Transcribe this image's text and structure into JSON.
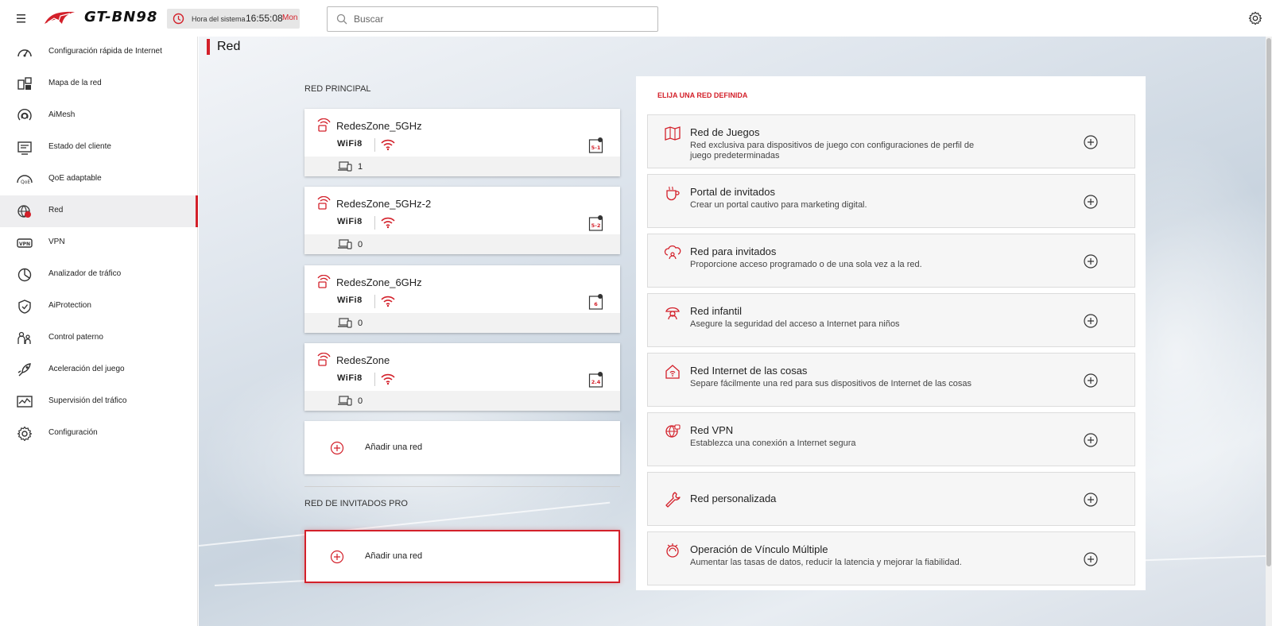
{
  "header": {
    "model": "GT-BN98",
    "system_time_label": "Hora del sistema",
    "time": "16:55:08",
    "day": "Mon",
    "search_placeholder": "Buscar"
  },
  "sidebar": {
    "items": [
      {
        "label": "Configuración rápida de Internet",
        "icon": "gauge-icon"
      },
      {
        "label": "Mapa de la red",
        "icon": "network-map-icon"
      },
      {
        "label": "AiMesh",
        "icon": "aimesh-icon"
      },
      {
        "label": "Estado del cliente",
        "icon": "client-status-icon"
      },
      {
        "label": "QoE adaptable",
        "icon": "qos-icon"
      },
      {
        "label": "Red",
        "icon": "globe-icon",
        "active": true
      },
      {
        "label": "VPN",
        "icon": "vpn-icon"
      },
      {
        "label": "Analizador de tráfico",
        "icon": "pie-chart-icon"
      },
      {
        "label": "AiProtection",
        "icon": "shield-icon"
      },
      {
        "label": "Control paterno",
        "icon": "parental-icon"
      },
      {
        "label": "Aceleración del juego",
        "icon": "rocket-icon"
      },
      {
        "label": "Supervisión del tráfico",
        "icon": "traffic-monitor-icon"
      },
      {
        "label": "Configuración",
        "icon": "gear-icon"
      }
    ]
  },
  "page": {
    "title": "Red",
    "main_section": "RED PRINCIPAL",
    "guest_pro_section": "RED DE INVITADOS PRO",
    "add_network": "Añadir una red",
    "networks": [
      {
        "ssid": "RedesZone_5GHz",
        "wifi_label": "WiFi8",
        "band_label": "5-1",
        "devices": "1"
      },
      {
        "ssid": "RedesZone_5GHz-2",
        "wifi_label": "WiFi8",
        "band_label": "5-2",
        "devices": "0"
      },
      {
        "ssid": "RedesZone_6GHz",
        "wifi_label": "WiFi8",
        "band_label": "6",
        "devices": "0"
      },
      {
        "ssid": "RedesZone",
        "wifi_label": "WiFi8",
        "band_label": "2.4",
        "devices": "0"
      }
    ]
  },
  "right_panel": {
    "title": "ELIJA UNA RED DEFINIDA",
    "options": [
      {
        "name": "Red de Juegos",
        "desc": "Red exclusiva para dispositivos de juego con configuraciones de perfil de juego predeterminadas",
        "icon": "gamepad-map-icon"
      },
      {
        "name": "Portal de invitados",
        "desc": "Crear un portal cautivo para marketing digital.",
        "icon": "coffee-cup-icon"
      },
      {
        "name": "Red para invitados",
        "desc": "Proporcione acceso programado o de una sola vez a la red.",
        "icon": "guest-cloud-icon"
      },
      {
        "name": "Red infantil",
        "desc": "Asegure la seguridad del acceso a Internet para niños",
        "icon": "child-icon"
      },
      {
        "name": "Red Internet de las cosas",
        "desc": "Separe fácilmente una red para sus dispositivos de Internet de las cosas",
        "icon": "iot-home-icon"
      },
      {
        "name": "Red VPN",
        "desc": "Establezca una conexión a Internet segura",
        "icon": "vpn-globe-icon"
      },
      {
        "name": "Red personalizada",
        "desc": "",
        "icon": "wrench-icon"
      },
      {
        "name": "Operación de Vínculo Múltiple",
        "desc": "Aumentar las tasas de datos, reducir la latencia y mejorar la fiabilidad.",
        "icon": "multi-link-icon"
      }
    ]
  },
  "colors": {
    "accent": "#d3202a",
    "text": "#222222",
    "sidebar_active": "#eeeef0"
  }
}
